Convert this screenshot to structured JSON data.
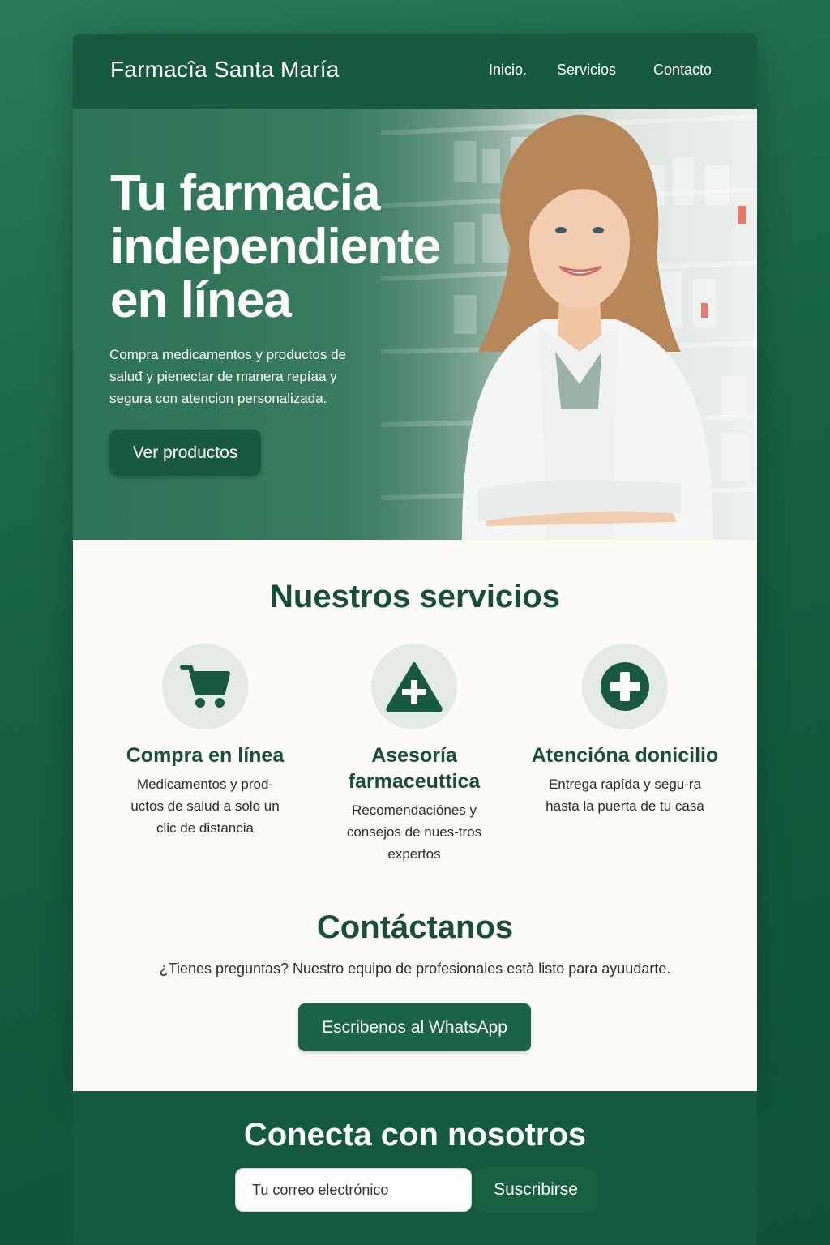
{
  "header": {
    "brand": "Farmacîa Santa María",
    "nav": [
      "Inicio.",
      "Servicios",
      "Contacto"
    ]
  },
  "hero": {
    "title": "Tu farmacia independiente en línea",
    "description": "Compra medicamentos y productos de saluđ y pienectar de manera repíaa y segura con atencion personalizada.",
    "button": "Ver productos"
  },
  "services": {
    "title": "Nuestros servicios",
    "items": [
      {
        "icon": "cart-icon",
        "title": "Compra en línea",
        "description": "Medicamentos y prod-uctos de salud a solo un clic de distancia"
      },
      {
        "icon": "triangle-plus-icon",
        "title": "Asesoría farmaceuttica",
        "description": "Recomendaciónes y consejos de nues-tros expertos"
      },
      {
        "icon": "circle-plus-icon",
        "title": "Atencióna donicilio",
        "description": "Entrega rapída y segu-ra hasta la puerta de tu casa"
      }
    ]
  },
  "contact": {
    "title": "Contáctanos",
    "text": "¿Tienes preguntas? Nuestro equipo de profesionales està listo para ayuudarte.",
    "button": "Escribenos al WhatsApp"
  },
  "newsletter": {
    "title": "Conecta con nosotros",
    "placeholder": "Tu correo electrónico",
    "button": "Suscribirse"
  },
  "colors": {
    "brand_green": "#175a3f",
    "accent_dark_green": "#184f39",
    "page_background": "#fdfbf5",
    "icon_circle": "#e3ebe2"
  }
}
